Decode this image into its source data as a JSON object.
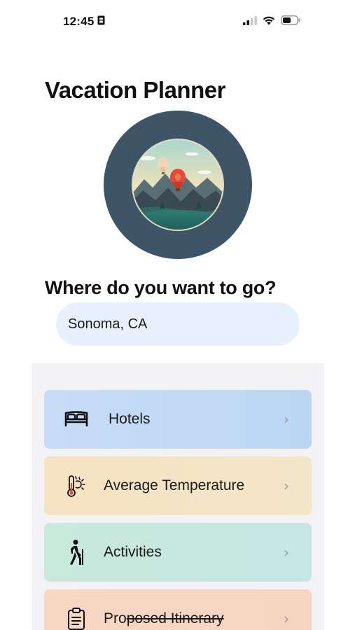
{
  "status_bar": {
    "time": "12:45",
    "sim_icon": "sim-card-icon",
    "signal_icon": "cellular-signal-icon",
    "wifi_icon": "wifi-icon",
    "battery_icon": "battery-icon"
  },
  "app": {
    "title": "Vacation Planner",
    "hero_image": "hot-air-balloon-mountains-illustration"
  },
  "destination": {
    "question": "Where do you want to go?",
    "value": "Sonoma, CA"
  },
  "options": [
    {
      "label": "Hotels",
      "icon": "bed-icon",
      "chevron": "›",
      "color": "#c7dcf7"
    },
    {
      "label": "Average Temperature",
      "icon": "thermometer-sun-icon",
      "chevron": "›",
      "color": "#f6e2c2"
    },
    {
      "label": "Activities",
      "icon": "hiker-icon",
      "chevron": "›",
      "color": "#c9e9dc"
    },
    {
      "label_prefix": "Pro",
      "label_struck": "posed Itinerary",
      "icon": "clipboard-icon",
      "chevron": "›",
      "color": "#f9d7c5"
    }
  ]
}
